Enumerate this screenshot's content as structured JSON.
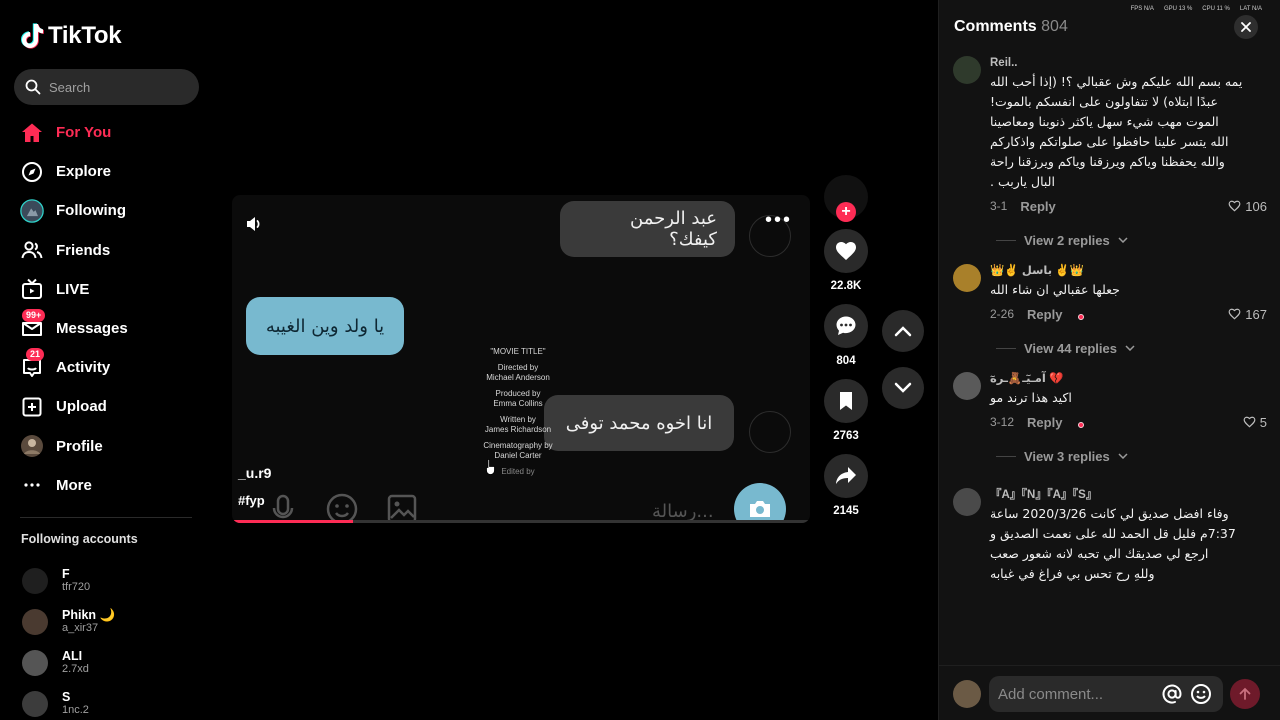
{
  "app": {
    "name": "TikTok"
  },
  "search": {
    "placeholder": "Search"
  },
  "nav": [
    {
      "label": "For You",
      "icon": "home-icon",
      "active": true
    },
    {
      "label": "Explore",
      "icon": "compass-icon"
    },
    {
      "label": "Following",
      "icon": "following-avatar-icon"
    },
    {
      "label": "Friends",
      "icon": "friends-icon"
    },
    {
      "label": "LIVE",
      "icon": "live-tv-icon"
    },
    {
      "label": "Messages",
      "icon": "messages-icon",
      "badge": "99+"
    },
    {
      "label": "Activity",
      "icon": "activity-icon",
      "badge": "21"
    },
    {
      "label": "Upload",
      "icon": "upload-icon"
    },
    {
      "label": "Profile",
      "icon": "profile-avatar-icon"
    },
    {
      "label": "More",
      "icon": "more-dots-icon"
    }
  ],
  "following_title": "Following accounts",
  "following": [
    {
      "name": "F",
      "user": "tfr720"
    },
    {
      "name": "Phikn 🌙",
      "user": "a_xir37"
    },
    {
      "name": "ALI",
      "user": "2.7xd"
    },
    {
      "name": "S",
      "user": "1nc.2"
    }
  ],
  "status": {
    "fps": "FPS N/A",
    "gpu": "GPU 13 %",
    "cpu": "CPU 11 %",
    "lat": "LAT N/A"
  },
  "video": {
    "bubble1": "عبد الرحمن كيفك؟",
    "bubble2": "يا ولد وين الغيبه",
    "bubble3": "انا اخوه محمد توفى",
    "credits": {
      "movie_title": "\"MOVIE TITLE\"",
      "directed_label": "Directed by",
      "directed": "Michael Anderson",
      "produced_label": "Produced by",
      "produced": "Emma Collins",
      "written_label": "Written by",
      "written": "James Richardson",
      "cinema_label": "Cinematography by",
      "cinema": "Daniel Carter",
      "edited_label": "Edited by"
    },
    "message_placeholder": "رسالة...",
    "author": "_u.r9",
    "hashtag": "#fyp",
    "progress": 0.21
  },
  "actions": {
    "likes": "22.8K",
    "comments": "804",
    "saves": "2763",
    "shares": "2145"
  },
  "comments": {
    "title": "Comments",
    "count": "804",
    "items": [
      {
        "user": "Reil..",
        "text": "يمه بسم الله عليكم وش عقبالي ؟! (إذا أحب الله\nعبدًا ابتلاه) لا تتفاولون على انفسكم بالموت!\nالموت مهب شيء سهل ياكثر ذنوبنا ومعاصينا\nالله يتسر علينا حافظوا على صلواتكم واذكاركم\nوالله يحفظنا وياكم ويرزقنا وياكم ويرزقنا راحة\nالبال ياربب .",
        "date": "3-1",
        "reply": "Reply",
        "likes": "106",
        "view_replies": "View 2 replies"
      },
      {
        "user": "👑✌️ باسل ✌️👑",
        "text": "جعلها عقبالي ان شاء الله",
        "date": "2-26",
        "reply": "Reply",
        "likes": "167",
        "view_replies": "View 44 replies"
      },
      {
        "user": "آمـيٓـ🧸ـرهٓ 💔",
        "text": "اكيد هذا ترند مو",
        "date": "3-12",
        "reply": "Reply",
        "likes": "5",
        "view_replies": "View 3 replies"
      },
      {
        "user": "『A』『N』『A』『S』",
        "text": "وفاء افضل صديق لي كانت 2020/3/26 ساعة\n7:37م فليل قل الحمد لله على نعمت الصديق و\nارجع لي صديقك الي تحبه لانه شعور صعب\nوللهِ رح تحس بي فراغ في غيابه"
      }
    ],
    "add_placeholder": "Add comment..."
  }
}
